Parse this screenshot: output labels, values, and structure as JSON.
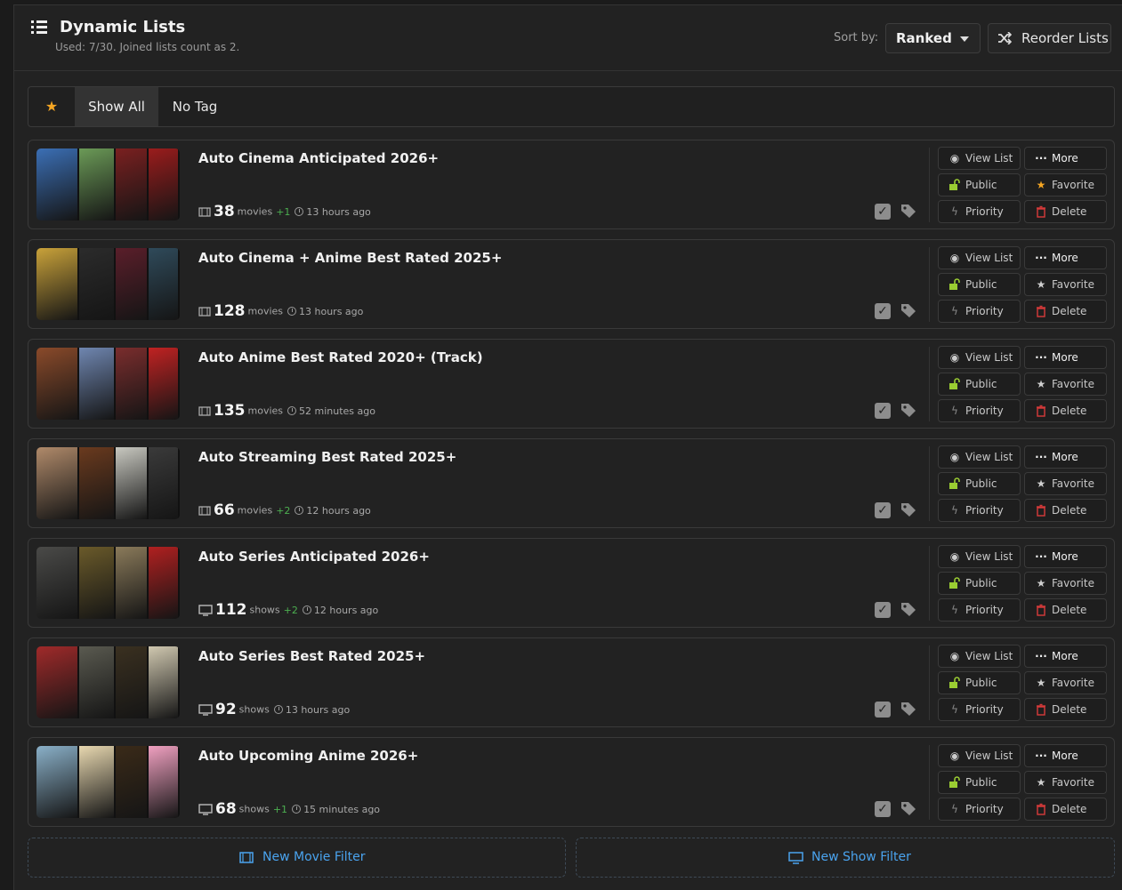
{
  "header": {
    "title": "Dynamic Lists",
    "subtitle": "Used: 7/30. Joined lists count as 2.",
    "sort_label": "Sort by:",
    "sort_value": "Ranked",
    "reorder_label": "Reorder Lists"
  },
  "tags": {
    "favorites_icon": "star-icon",
    "show_all": "Show All",
    "no_tag": "No Tag"
  },
  "actions": {
    "view_list": "View List",
    "more": "More",
    "public": "Public",
    "favorite": "Favorite",
    "priority": "Priority",
    "delete": "Delete"
  },
  "lists": [
    {
      "title": "Auto Cinema Anticipated 2026+",
      "count": "38",
      "unit": "movies",
      "delta": "+1",
      "ago": "13 hours ago",
      "media_icon": "film-icon",
      "favorite": true,
      "posters": [
        "#3b6fb5",
        "#6b9a57",
        "#7a2020",
        "#9a1c1c"
      ]
    },
    {
      "title": "Auto Cinema + Anime Best Rated 2025+",
      "count": "128",
      "unit": "movies",
      "delta": "",
      "ago": "13 hours ago",
      "media_icon": "film-icon",
      "favorite": false,
      "posters": [
        "#c9a23a",
        "#2b2b2b",
        "#5a1e2a",
        "#2f4a5a"
      ]
    },
    {
      "title": "Auto Anime Best Rated 2020+ (Track)",
      "count": "135",
      "unit": "movies",
      "delta": "",
      "ago": "52 minutes ago",
      "media_icon": "film-icon",
      "favorite": false,
      "posters": [
        "#8a4a2a",
        "#6f86b0",
        "#7a2d2d",
        "#c02222"
      ]
    },
    {
      "title": "Auto Streaming Best Rated 2025+",
      "count": "66",
      "unit": "movies",
      "delta": "+2",
      "ago": "12 hours ago",
      "media_icon": "film-icon",
      "favorite": false,
      "posters": [
        "#b08a6a",
        "#6a3a1e",
        "#c8c8c0",
        "#3a3a3a"
      ]
    },
    {
      "title": "Auto Series Anticipated 2026+",
      "count": "112",
      "unit": "shows",
      "delta": "+2",
      "ago": "12 hours ago",
      "media_icon": "tv-icon",
      "favorite": false,
      "posters": [
        "#4a4a48",
        "#6a5a2a",
        "#8a7a5a",
        "#b02020"
      ]
    },
    {
      "title": "Auto Series Best Rated 2025+",
      "count": "92",
      "unit": "shows",
      "delta": "",
      "ago": "13 hours ago",
      "media_icon": "tv-icon",
      "favorite": false,
      "posters": [
        "#a02a2a",
        "#5a5a50",
        "#3a3020",
        "#d0c8b0"
      ]
    },
    {
      "title": "Auto Upcoming Anime 2026+",
      "count": "68",
      "unit": "shows",
      "delta": "+1",
      "ago": "15 minutes ago",
      "media_icon": "tv-icon",
      "favorite": false,
      "posters": [
        "#8ab0c8",
        "#e8d8b0",
        "#3a2a18",
        "#f0a0c0"
      ]
    }
  ],
  "footer": {
    "new_movie": "New Movie Filter",
    "new_show": "New Show Filter"
  },
  "colors": {
    "accent": "#4aa3ee",
    "delta": "#4caf50",
    "public_lock": "#9acd32",
    "favorite_star": "#f5a623",
    "delete": "#d83a3a"
  }
}
